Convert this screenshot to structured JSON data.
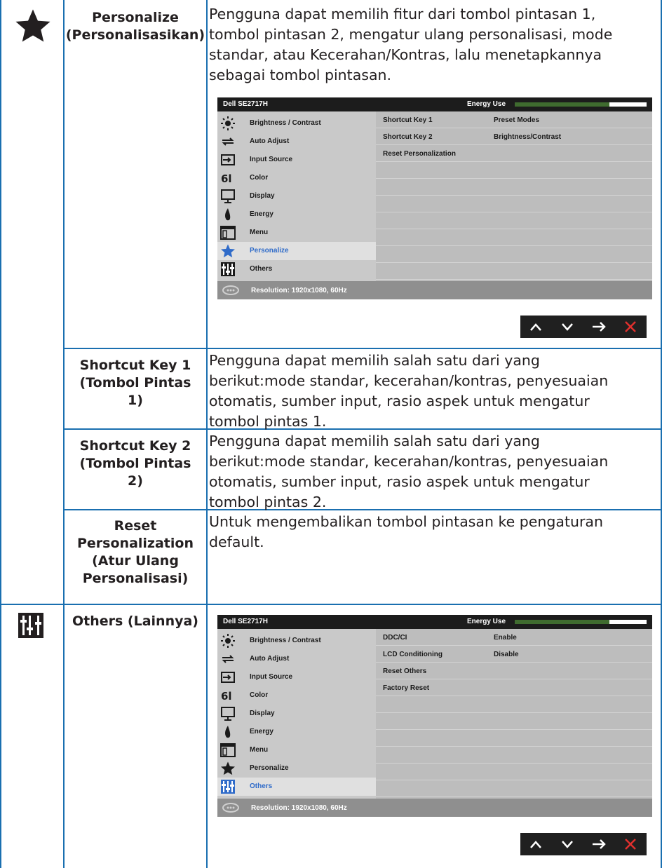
{
  "rows": [
    {
      "icon": "star-icon",
      "label": "Personalize (Personalisasikan)",
      "label_lines": [
        "Personalize",
        "(Personalisasikan)"
      ],
      "description_lines": [
        "Pengguna dapat memilih fitur dari tombol pintasan 1,",
        "tombol pintasan 2, mengatur ulang personalisasi, mode",
        "standar, atau Kecerahan/Kontras, lalu menetapkannya",
        "sebagai tombol pintasan."
      ]
    },
    {
      "label_lines": [
        "Shortcut Key 1",
        "(Tombol Pintas",
        "1)"
      ],
      "description_lines": [
        "Pengguna dapat memilih salah satu dari yang",
        "berikut:mode standar, kecerahan/kontras, penyesuaian",
        "otomatis, sumber input, rasio aspek untuk mengatur",
        "tombol pintas 1."
      ]
    },
    {
      "label_lines": [
        "Shortcut Key 2",
        "(Tombol Pintas",
        "2)"
      ],
      "description_lines": [
        "Pengguna dapat memilih salah satu dari yang",
        "berikut:mode standar, kecerahan/kontras, penyesuaian",
        "otomatis, sumber input, rasio aspek untuk mengatur",
        "tombol pintas 2."
      ]
    },
    {
      "label_lines": [
        "Reset",
        "Personalization",
        "(Atur Ulang",
        "Personalisasi)"
      ],
      "description_lines": [
        "Untuk mengembalikan tombol pintasan ke pengaturan",
        "default."
      ]
    },
    {
      "icon": "others-sliders-icon",
      "label_lines": [
        "Others (Lainnya)"
      ]
    }
  ],
  "osd_common": {
    "model": "Dell SE2717H",
    "energy_label": "Energy Use",
    "energy_level": 0.72,
    "menu": [
      {
        "label": "Brightness / Contrast",
        "icon": "brightness-icon"
      },
      {
        "label": "Auto Adjust",
        "icon": "auto-adjust-icon"
      },
      {
        "label": "Input Source",
        "icon": "input-source-icon"
      },
      {
        "label": "Color",
        "icon": "color-icon"
      },
      {
        "label": "Display",
        "icon": "display-icon"
      },
      {
        "label": "Energy",
        "icon": "energy-icon"
      },
      {
        "label": "Menu",
        "icon": "menu-icon"
      },
      {
        "label": "Personalize",
        "icon": "star-icon"
      },
      {
        "label": "Others",
        "icon": "others-sliders-icon"
      }
    ],
    "resolution": "Resolution: 1920x1080, 60Hz",
    "nav_buttons": [
      "up-arrow-icon",
      "down-arrow-icon",
      "right-arrow-icon",
      "close-icon"
    ],
    "colors": {
      "accent": "#2f6bc9",
      "close": "#e0302e",
      "border": "#1a6fb0",
      "energy": "#3f6b2f"
    }
  },
  "osd1": {
    "selected": 7,
    "settings": [
      {
        "key": "Shortcut Key 1",
        "value": "Preset Modes"
      },
      {
        "key": "Shortcut Key 2",
        "value": "Brightness/Contrast"
      },
      {
        "key": "Reset Personalization",
        "value": ""
      },
      {
        "key": "",
        "value": ""
      },
      {
        "key": "",
        "value": ""
      },
      {
        "key": "",
        "value": ""
      },
      {
        "key": "",
        "value": ""
      },
      {
        "key": "",
        "value": ""
      },
      {
        "key": "",
        "value": ""
      },
      {
        "key": "",
        "value": ""
      }
    ]
  },
  "osd2": {
    "selected": 8,
    "settings": [
      {
        "key": "DDC/CI",
        "value": "Enable"
      },
      {
        "key": "LCD Conditioning",
        "value": "Disable"
      },
      {
        "key": "Reset Others",
        "value": ""
      },
      {
        "key": "Factory Reset",
        "value": ""
      },
      {
        "key": "",
        "value": ""
      },
      {
        "key": "",
        "value": ""
      },
      {
        "key": "",
        "value": ""
      },
      {
        "key": "",
        "value": ""
      },
      {
        "key": "",
        "value": ""
      },
      {
        "key": "",
        "value": ""
      }
    ]
  }
}
